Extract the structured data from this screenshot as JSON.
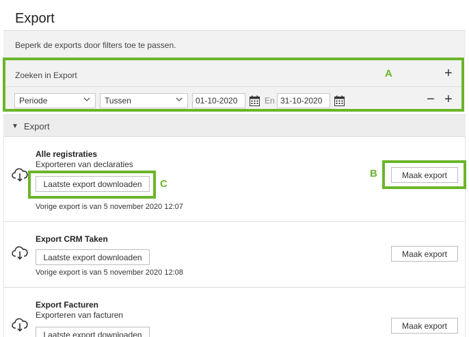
{
  "page": {
    "title": "Export",
    "hint": "Beperk de exports door filters toe te passen."
  },
  "filters": {
    "title": "Zoeken in Export",
    "period_select": "Periode",
    "mode_select": "Tussen",
    "date_from": "01-10-2020",
    "en_label": "En",
    "date_to": "31-10-2020",
    "add_symbol": "+",
    "remove_symbol": "−"
  },
  "annotations": {
    "a": "A",
    "b": "B",
    "c": "C",
    "highlight_color": "#6bb52c"
  },
  "section": {
    "caret": "▼",
    "title": "Export"
  },
  "exports": [
    {
      "title": "Alle registraties",
      "subtitle": "Exporteren van declaraties",
      "download_label": "Laatste export downloaden",
      "previous": "Vorige export is van 5 november 2020 12:07",
      "export_label": "Maak export"
    },
    {
      "title": "Export CRM Taken",
      "subtitle": "",
      "download_label": "Laatste export downloaden",
      "previous": "Vorige export is van 5 november 2020 12:08",
      "export_label": "Maak export"
    },
    {
      "title": "Export Facturen",
      "subtitle": "Exporteren van facturen",
      "download_label": "Laatste export downloaden",
      "previous": "",
      "export_label": "Maak export"
    }
  ]
}
